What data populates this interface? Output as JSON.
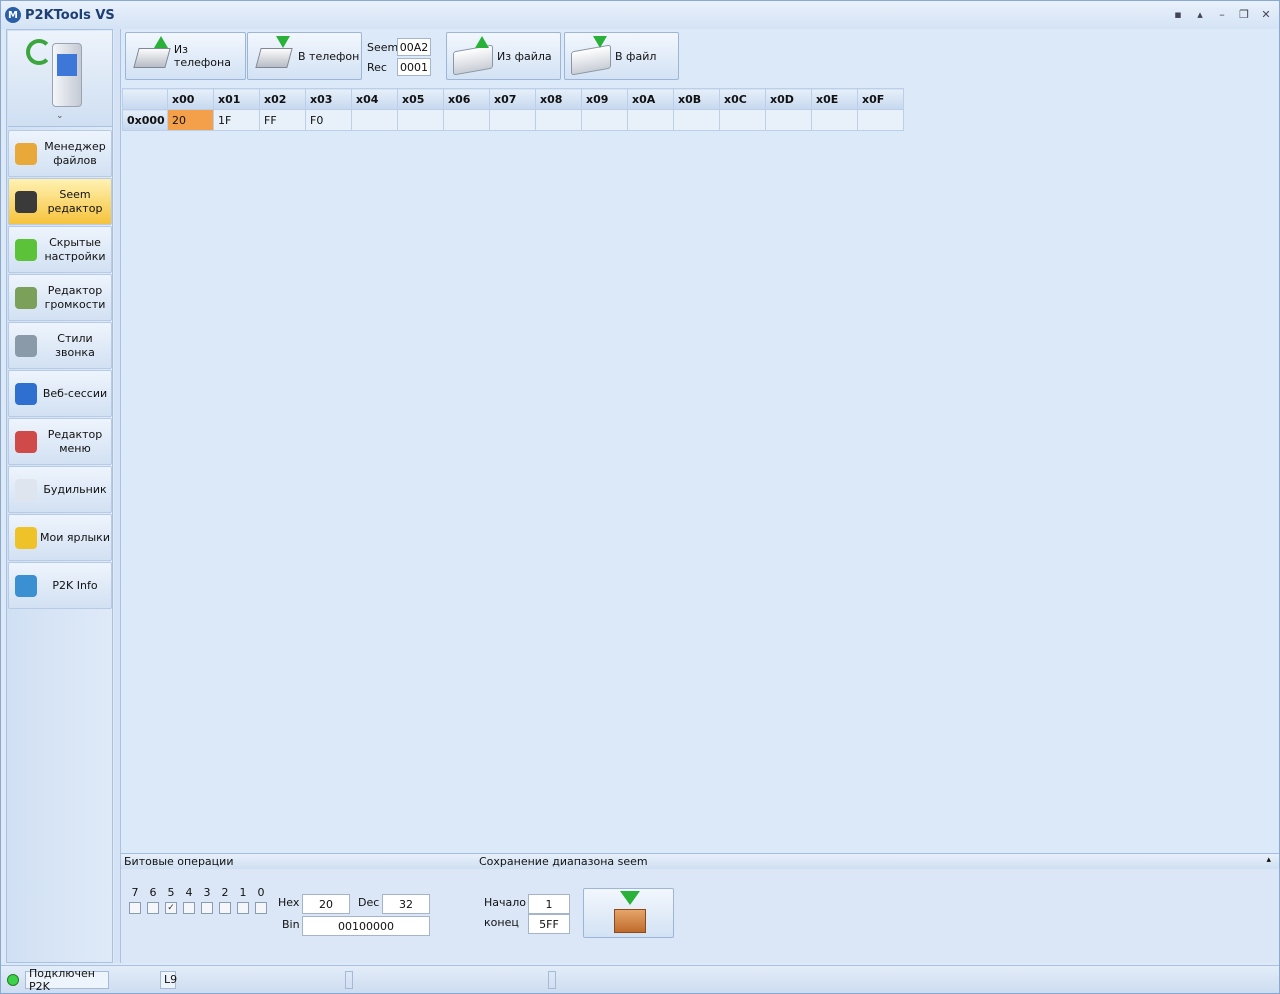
{
  "window": {
    "title": "P2KTools VS",
    "logo": "motorola-logo-icon"
  },
  "sidebar": {
    "items": [
      {
        "label": "Менеджер\nфайлов",
        "icon": "file-manager-icon",
        "color": "#e9a83a"
      },
      {
        "label": "Seem\nредактор",
        "icon": "seem-editor-icon",
        "color": "#3a3a3a",
        "active": true
      },
      {
        "label": "Скрытые\nнастройки",
        "icon": "gear-icon",
        "color": "#5cc23a"
      },
      {
        "label": "Редактор\nгромкости",
        "icon": "volume-icon",
        "color": "#7aa05a"
      },
      {
        "label": "Стили звонка",
        "icon": "ringtone-icon",
        "color": "#8a9aa8"
      },
      {
        "label": "Веб-сессии",
        "icon": "globe-icon",
        "color": "#2e6fd0"
      },
      {
        "label": "Редактор\nменю",
        "icon": "menu-editor-icon",
        "color": "#d04a4a"
      },
      {
        "label": "Будильник",
        "icon": "clock-icon",
        "color": "#dfe5ee"
      },
      {
        "label": "Мои ярлыки",
        "icon": "shortcuts-icon",
        "color": "#f0c22a"
      },
      {
        "label": "P2K Info",
        "icon": "info-icon",
        "color": "#3a90d0"
      }
    ]
  },
  "toolbar": {
    "from_phone": "Из телефона",
    "to_phone": "В телефон",
    "seem_label": "Seem",
    "seem_value": "00A2",
    "rec_label": "Rec",
    "rec_value": "0001",
    "from_file": "Из файла",
    "to_file": "В файл"
  },
  "grid": {
    "columns": [
      "x00",
      "x01",
      "x02",
      "x03",
      "x04",
      "x05",
      "x06",
      "x07",
      "x08",
      "x09",
      "x0A",
      "x0B",
      "x0C",
      "x0D",
      "x0E",
      "x0F"
    ],
    "rows": [
      {
        "offset": "0x000",
        "cells": [
          "20",
          "1F",
          "FF",
          "F0",
          "",
          "",
          "",
          "",
          "",
          "",
          "",
          "",
          "",
          "",
          "",
          ""
        ]
      }
    ]
  },
  "bitops": {
    "title": "Битовые операции",
    "bits": [
      "7",
      "6",
      "5",
      "4",
      "3",
      "2",
      "1",
      "0"
    ],
    "checked": [
      false,
      false,
      true,
      false,
      false,
      false,
      false,
      false
    ],
    "hex_label": "Hex",
    "hex_value": "20",
    "dec_label": "Dec",
    "dec_value": "32",
    "bin_label": "Bin",
    "bin_value": "00100000"
  },
  "save_range": {
    "title": "Сохранение диапазона seem",
    "start_label": "Начало",
    "start_value": "1",
    "end_label": "конец",
    "end_value": "5FF"
  },
  "status": {
    "connection": "Подключен P2K",
    "model": "L9"
  }
}
